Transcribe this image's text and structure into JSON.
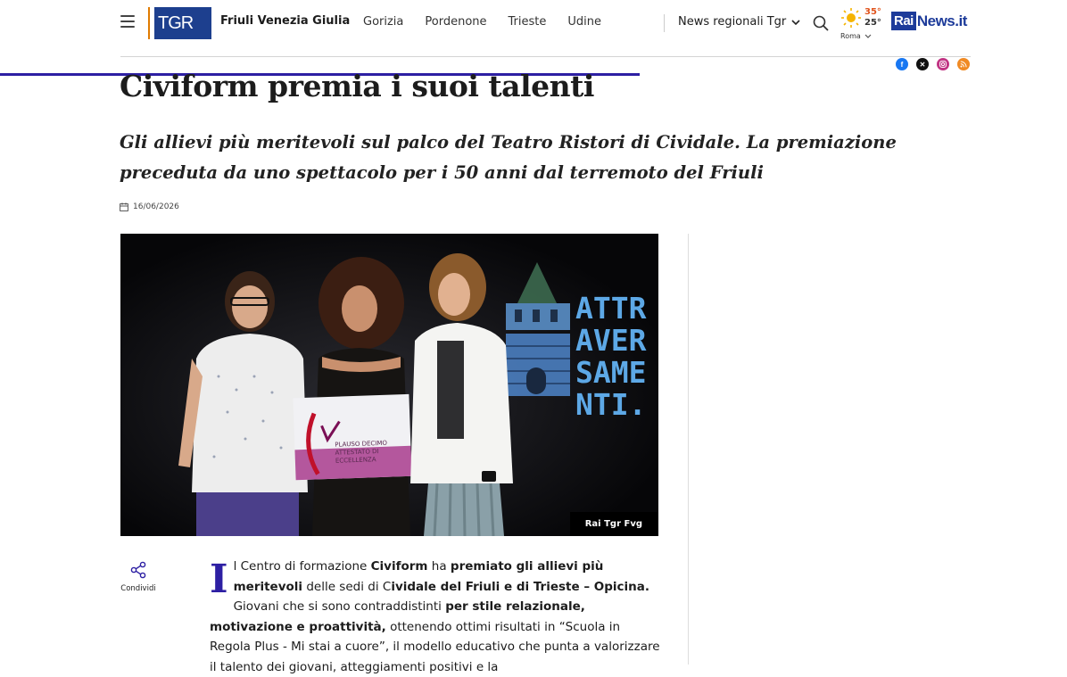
{
  "header": {
    "logo_text": "TGR",
    "region": "Friuli Venezia Giulia",
    "nav": [
      "Gorizia",
      "Pordenone",
      "Trieste",
      "Udine"
    ],
    "news_dropdown": "News regionali Tgr",
    "weather": {
      "high": "35°",
      "low": "25°",
      "city": "Roma"
    },
    "brand_rai": "Rai",
    "brand_news": "News.it"
  },
  "colors": {
    "accent": "#2d1fa3",
    "brand": "#1d3b9a",
    "orange": "#e07b00"
  },
  "socials": [
    "facebook-icon",
    "x-icon",
    "instagram-icon",
    "rss-icon"
  ],
  "article": {
    "title": "Civiform premia i suoi talenti",
    "subtitle": "Gli allievi più meritevoli sul palco del Teatro Ristori di Cividale. La premiazione preceduta da uno spettacolo per i 50 anni dal terremoto del Friuli",
    "date": "16/06/2026",
    "photo_caption": "Rai Tgr Fvg",
    "photo_text": {
      "certificate": "PLAUSO DECIMO\nATTESTATO DI\nECCELLENZA",
      "backdrop": [
        "ATTR",
        "AVER",
        "SAME",
        "NTI."
      ]
    },
    "share_label": "Condividi",
    "body": {
      "dropcap": "I",
      "s1": "l Centro di formazione ",
      "b1": "Civiform",
      "s2": " ha ",
      "b2": "premiato gli allievi più meritevoli",
      "s3": " delle sedi di C",
      "b3": "ividale del Friuli e di Trieste – Opicina.",
      "s4": " Giovani che si sono contraddistinti ",
      "b4": "per stile relazionale, motivazione e proattività,",
      "s5": " ottenendo ottimi risultati in “Scuola in Regola Plus - Mi stai a cuore”, il modello educativo che punta a valorizzare il talento dei giovani, atteggiamenti positivi e la"
    }
  }
}
